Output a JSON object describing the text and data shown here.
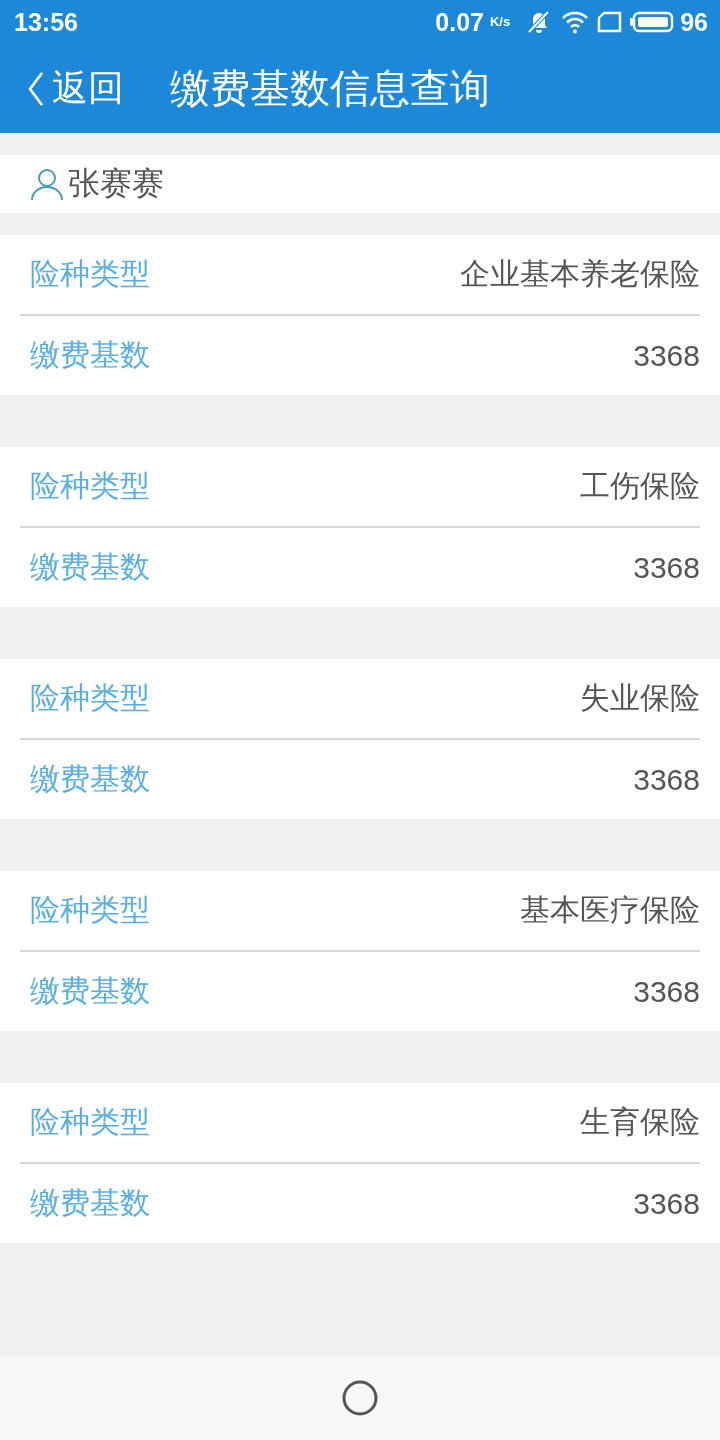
{
  "status_bar": {
    "time": "13:56",
    "net_speed": "0.07",
    "net_unit": "K/s",
    "battery": "96"
  },
  "header": {
    "back": "返回",
    "title": "缴费基数信息查询"
  },
  "user": {
    "name": "张赛赛"
  },
  "records": [
    {
      "fields": [
        {
          "label": "险种类型",
          "value": "企业基本养老保险"
        },
        {
          "label": "缴费基数",
          "value": "3368"
        }
      ]
    },
    {
      "fields": [
        {
          "label": "险种类型",
          "value": "工伤保险"
        },
        {
          "label": "缴费基数",
          "value": "3368"
        }
      ]
    },
    {
      "fields": [
        {
          "label": "险种类型",
          "value": "失业保险"
        },
        {
          "label": "缴费基数",
          "value": "3368"
        }
      ]
    },
    {
      "fields": [
        {
          "label": "险种类型",
          "value": "基本医疗保险"
        },
        {
          "label": "缴费基数",
          "value": "3368"
        }
      ]
    },
    {
      "fields": [
        {
          "label": "险种类型",
          "value": "生育保险"
        },
        {
          "label": "缴费基数",
          "value": "3368"
        }
      ]
    }
  ]
}
